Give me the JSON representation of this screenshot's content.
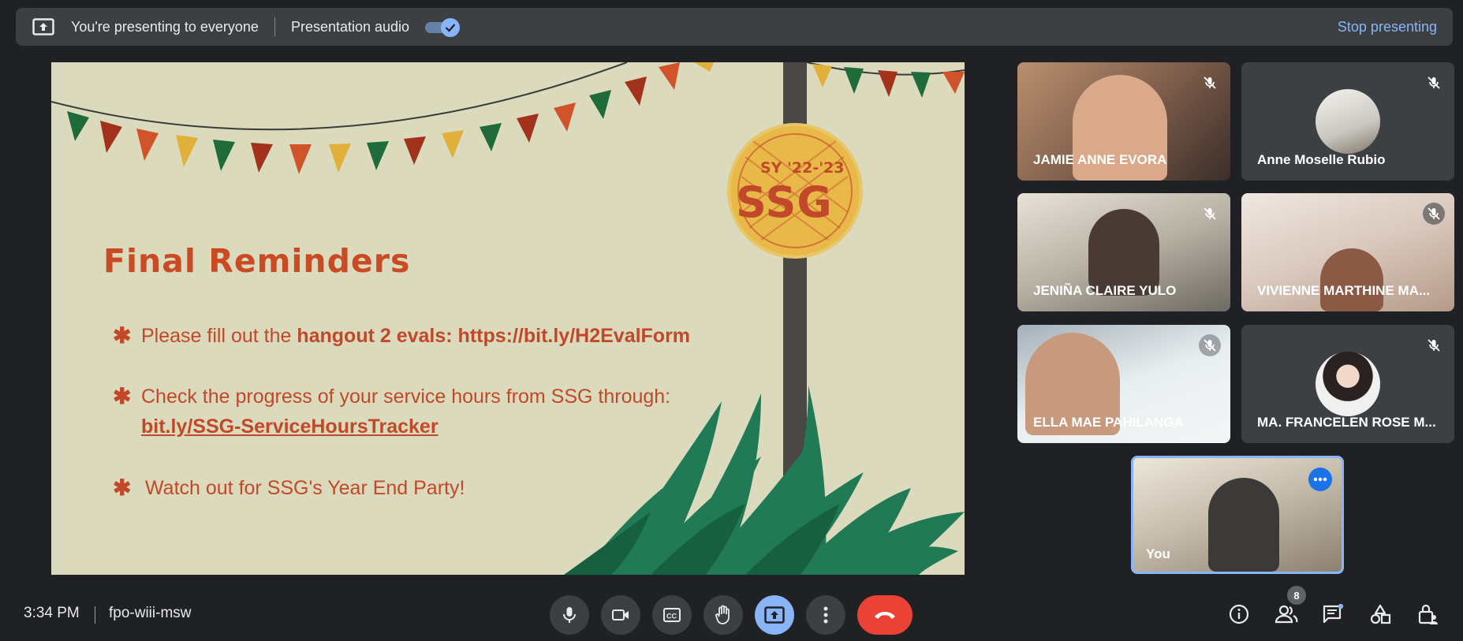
{
  "topbar": {
    "presenting_text": "You're presenting to everyone",
    "audio_label": "Presentation audio",
    "stop_label": "Stop presenting"
  },
  "slide": {
    "badge_year": "SY '22-'23",
    "badge_text": "SSG",
    "title": "Final Reminders",
    "bullet1_prefix": "Please fill out the ",
    "bullet1_bold": "hangout 2 evals: https://bit.ly/H2EvalForm",
    "bullet2_line1": "Check the progress of your service hours from SSG through:",
    "bullet2_link": "bit.ly/SSG-ServiceHoursTracker",
    "bullet3": "Watch out for SSG's Year End Party!"
  },
  "participants": [
    {
      "name": "JAMIE ANNE EVORA",
      "muted": true
    },
    {
      "name": "Anne Moselle Rubio",
      "muted": true
    },
    {
      "name": "JENIÑA CLAIRE YULO",
      "muted": true
    },
    {
      "name": "VIVIENNE MARTHINE MA...",
      "muted": true
    },
    {
      "name": "ELLA MAE PAHILANGA",
      "muted": true
    },
    {
      "name": "MA. FRANCELEN ROSE M...",
      "muted": true
    },
    {
      "name": "You",
      "muted": false
    }
  ],
  "bottombar": {
    "time": "3:34 PM",
    "meeting_code": "fpo-wiii-msw",
    "people_count": "8"
  },
  "colors": {
    "background": "#202124",
    "panel": "#3c4043",
    "accent_blue": "#8ab4f8",
    "end_call_red": "#ea4335",
    "slide_bg": "#dcdabc",
    "slide_text": "#c2482a"
  }
}
